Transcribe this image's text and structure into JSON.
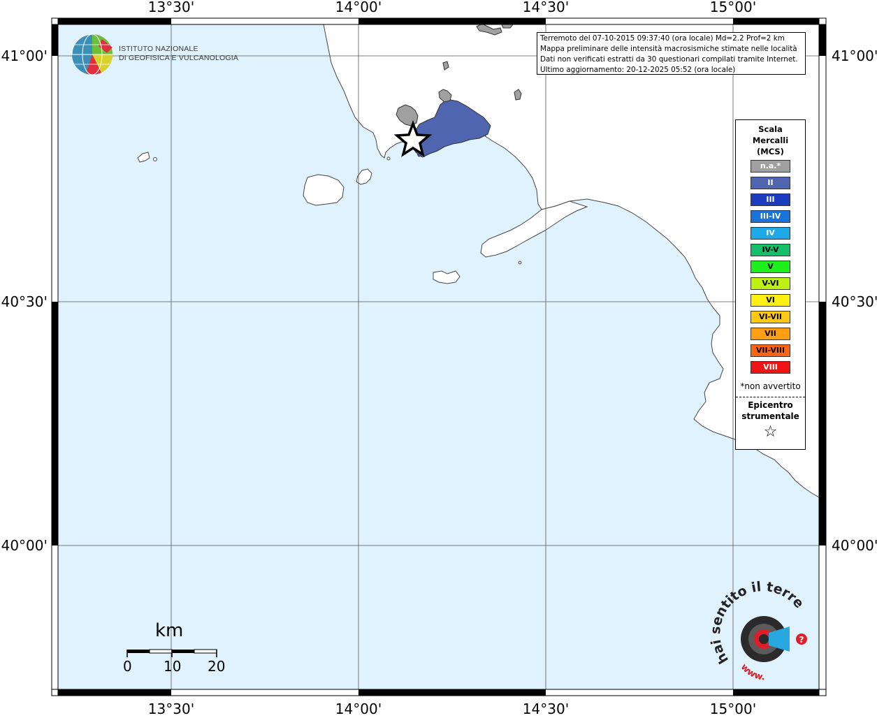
{
  "map": {
    "lon_labels": [
      "13°30'",
      "14°00'",
      "14°30'",
      "15°00'"
    ],
    "lat_labels": [
      "41°00'",
      "40°30'",
      "40°00'"
    ]
  },
  "info": {
    "line1": "Terremoto del 07-10-2015 09:37:40 (ora locale) Md=2.2 Prof=2 km",
    "line2": "Mappa preliminare delle intensità macrosismiche stimate nelle località",
    "line3": "Dati non verificati estratti da 30 questionari compilati tramite Internet.",
    "line4": "Ultimo aggiornamento: 20-12-2025 05:52 (ora locale)"
  },
  "logo": {
    "line1": "ISTITUTO NAZIONALE",
    "line2": "DI GEOFISICA E VULCANOLOGIA"
  },
  "legend": {
    "title1": "Scala",
    "title2": "Mercalli",
    "title3": "(MCS)",
    "items": [
      {
        "label": "n.a.*",
        "color": "#a0a0a0",
        "text": "#ffffff"
      },
      {
        "label": "II",
        "color": "#5065b0",
        "text": "#ffffff"
      },
      {
        "label": "III",
        "color": "#1c3cbf",
        "text": "#ffffff"
      },
      {
        "label": "III-IV",
        "color": "#1a73d8",
        "text": "#ffffff"
      },
      {
        "label": "IV",
        "color": "#1ea8e8",
        "text": "#ffffff"
      },
      {
        "label": "IV-V",
        "color": "#14c068",
        "text": "#000000"
      },
      {
        "label": "V",
        "color": "#1ef01e",
        "text": "#000000"
      },
      {
        "label": "V-VI",
        "color": "#bef014",
        "text": "#000000"
      },
      {
        "label": "VI",
        "color": "#fff014",
        "text": "#000000"
      },
      {
        "label": "VI-VII",
        "color": "#ffc814",
        "text": "#000000"
      },
      {
        "label": "VII",
        "color": "#ffa014",
        "text": "#000000"
      },
      {
        "label": "VII-VIII",
        "color": "#ff6414",
        "text": "#000000"
      },
      {
        "label": "VIII",
        "color": "#f01414",
        "text": "#ffffff"
      }
    ],
    "note": "*non avvertito",
    "epi1": "Epicentro",
    "epi2": "strumentale",
    "epi_star": "☆"
  },
  "scale": {
    "unit": "km",
    "ticks": [
      "0",
      "10",
      "20"
    ]
  },
  "brand": {
    "top_text": "hai sentito il terremoto.it",
    "bottom_text": "www."
  },
  "colors": {
    "sea": "#dff2fd",
    "intensity_II": "#5065b0",
    "na_gray": "#a0a0a0"
  }
}
